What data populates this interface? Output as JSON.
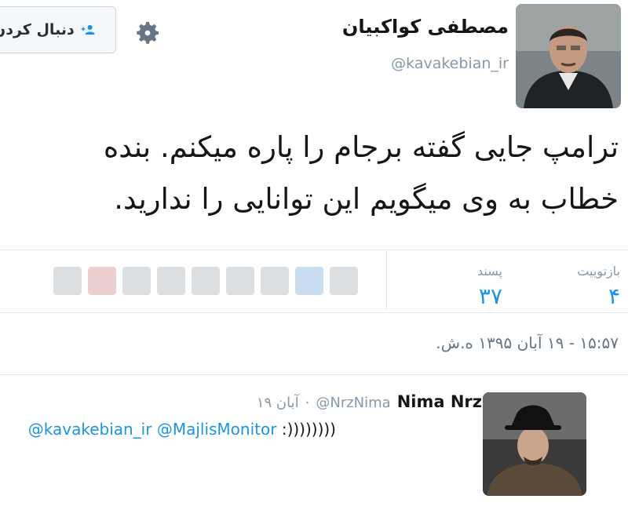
{
  "header": {
    "follow_label": "دنبال کردن",
    "follow_icon": "add-user-icon",
    "settings_icon": "gear-icon"
  },
  "author": {
    "name": "مصطفی کواکبیان",
    "handle": "@kavakebian_ir"
  },
  "tweet": {
    "line1": "ترامپ جایی گفته برجام را پاره میکنم. بنده",
    "line2": "خطاب به وی میگویم این توانایی را ندارید."
  },
  "stats": {
    "retweets_label": "بازتوییت",
    "retweets_value": "۴",
    "likes_label": "پسند",
    "likes_value": "۳۷"
  },
  "timestamp": "۱۵:۵۷ - ۱۹ آبان ۱۳۹۵ ه.ش.",
  "reply": {
    "name": "Nima Nrz",
    "handle": "@NrzNima",
    "date": "۱۹ آبان",
    "separator": "·",
    "mention1": "@kavakebian_ir",
    "mention2": "@MajlisMonitor",
    "text": ":))))))))"
  },
  "colors": {
    "accent": "#1b95e0",
    "muted": "#8899a6",
    "divider": "#e1e8ed"
  }
}
